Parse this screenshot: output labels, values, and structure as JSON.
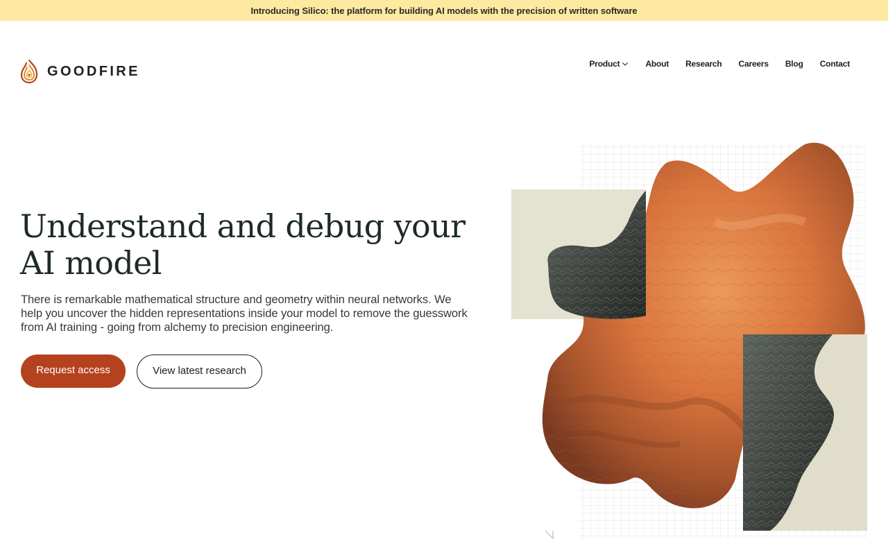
{
  "announcement": {
    "text": "Introducing Silico: the platform for building AI models with the precision of written software"
  },
  "brand": {
    "name": "GOODFIRE",
    "icon": "flame-spiral-logo-icon"
  },
  "nav": {
    "items": [
      {
        "label": "Product",
        "has_dropdown": true
      },
      {
        "label": "About"
      },
      {
        "label": "Research"
      },
      {
        "label": "Careers"
      },
      {
        "label": "Blog"
      },
      {
        "label": "Contact"
      }
    ]
  },
  "hero": {
    "headline": "Understand and debug your AI model",
    "subtext": "There is remarkable mathematical structure and geometry within neural networks. We help you uncover the hidden representations inside your model to remove the guesswork from AI training - going from alchemy to precision engineering.",
    "primary_cta": "Request access",
    "secondary_cta": "View latest research"
  },
  "colors": {
    "announcement_bg": "#fdeaa0",
    "primary_button": "#b5421f",
    "headline": "#1e2a2a",
    "art_orange": "#d9743d",
    "art_dark": "#3a403b",
    "art_panel": "#e4e2d1"
  }
}
